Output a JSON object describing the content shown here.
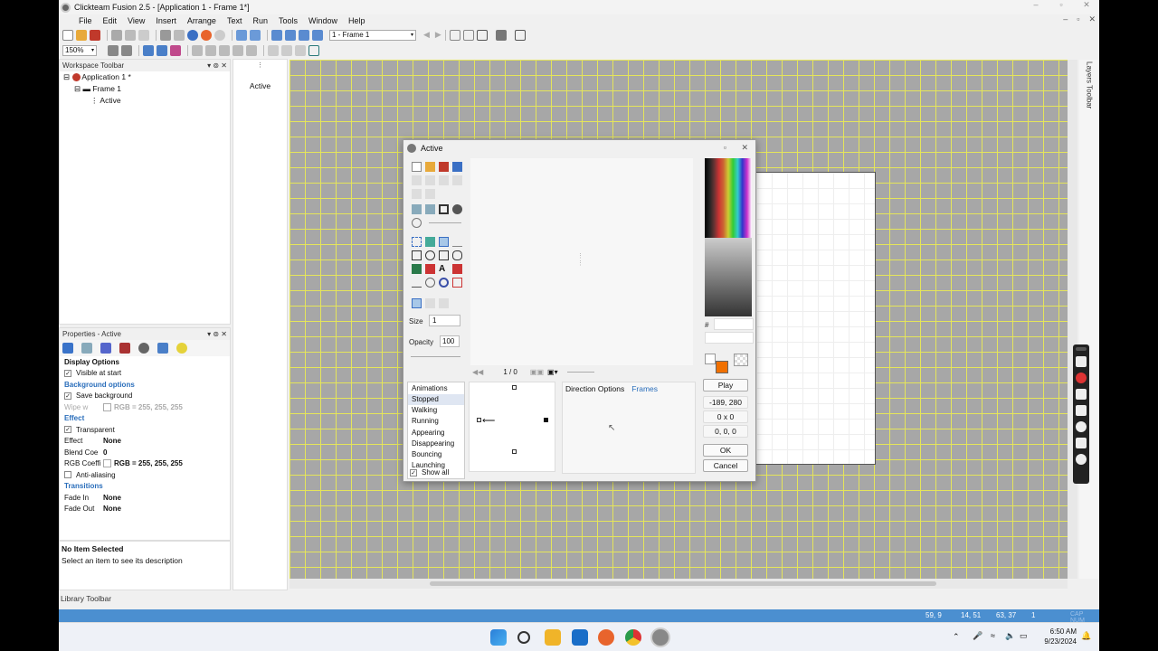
{
  "window": {
    "title": "Clickteam Fusion 2.5 - [Application 1 - Frame 1*]",
    "min": "–",
    "max": "▫",
    "close": "✕"
  },
  "menu": [
    "File",
    "Edit",
    "View",
    "Insert",
    "Arrange",
    "Text",
    "Run",
    "Tools",
    "Window",
    "Help"
  ],
  "mdi": {
    "min": "–",
    "restore": "▫",
    "close": "✕"
  },
  "toolbar": {
    "frame_select": "1 - Frame 1",
    "zoom": "150%"
  },
  "workspace": {
    "title": "Workspace Toolbar",
    "app": "Application 1 *",
    "frame": "Frame 1",
    "object": "Active"
  },
  "object_strip": {
    "label": "Active"
  },
  "properties": {
    "title": "Properties - Active",
    "rows": [
      {
        "type": "section",
        "label": "Display Options"
      },
      {
        "type": "check",
        "label": "Visible at start",
        "checked": true
      },
      {
        "type": "header",
        "label": "Background options"
      },
      {
        "type": "check",
        "label": "Save background",
        "checked": true
      },
      {
        "type": "kv",
        "label": "Wipe w",
        "value": "RGB = 255, 255, 255",
        "disabled": true
      },
      {
        "type": "header",
        "label": "Effect"
      },
      {
        "type": "check",
        "label": "Transparent",
        "checked": true
      },
      {
        "type": "kv",
        "label": "Effect",
        "value": "None"
      },
      {
        "type": "kv",
        "label": "Blend Coe",
        "value": "0"
      },
      {
        "type": "kv",
        "label": "RGB Coeffi",
        "value": "RGB = 255, 255, 255"
      },
      {
        "type": "check",
        "label": "Anti-aliasing",
        "checked": false
      },
      {
        "type": "header",
        "label": "Transitions"
      },
      {
        "type": "kv",
        "label": "Fade In",
        "value": "None"
      },
      {
        "type": "kv",
        "label": "Fade Out",
        "value": "None"
      }
    ],
    "desc_title": "No Item Selected",
    "desc_text": "Select an item to see its description"
  },
  "library": {
    "title": "Library Toolbar"
  },
  "layers": {
    "title": "Layers Toolbar"
  },
  "editor": {
    "title": "Active",
    "max": "▫",
    "close": "✕",
    "size_label": "Size",
    "size_value": "1",
    "opacity_label": "Opacity",
    "opacity_value": "100",
    "frame_counter": "1 / 0",
    "animations_title": "Animations",
    "animations": [
      "Stopped",
      "Walking",
      "Running",
      "Appearing",
      "Disappearing",
      "Bouncing",
      "Launching"
    ],
    "selected_animation": "Stopped",
    "show_all": "Show all",
    "direction_tab": "Direction Options",
    "frames_tab": "Frames",
    "hash": "#",
    "hex_value": "",
    "play": "Play",
    "hotspot": "-189, 280",
    "dimensions": "0 x 0",
    "action": "0, 0, 0",
    "ok": "OK",
    "cancel": "Cancel",
    "fg_color": "#f07000",
    "bg_color": "#ffffff"
  },
  "statusbar": {
    "items": [
      "59, 9",
      "14, 51",
      "63, 37",
      "1"
    ],
    "cap": "CAP NUM"
  },
  "taskbar": {
    "time": "6:50 AM",
    "date": "9/23/2024"
  }
}
